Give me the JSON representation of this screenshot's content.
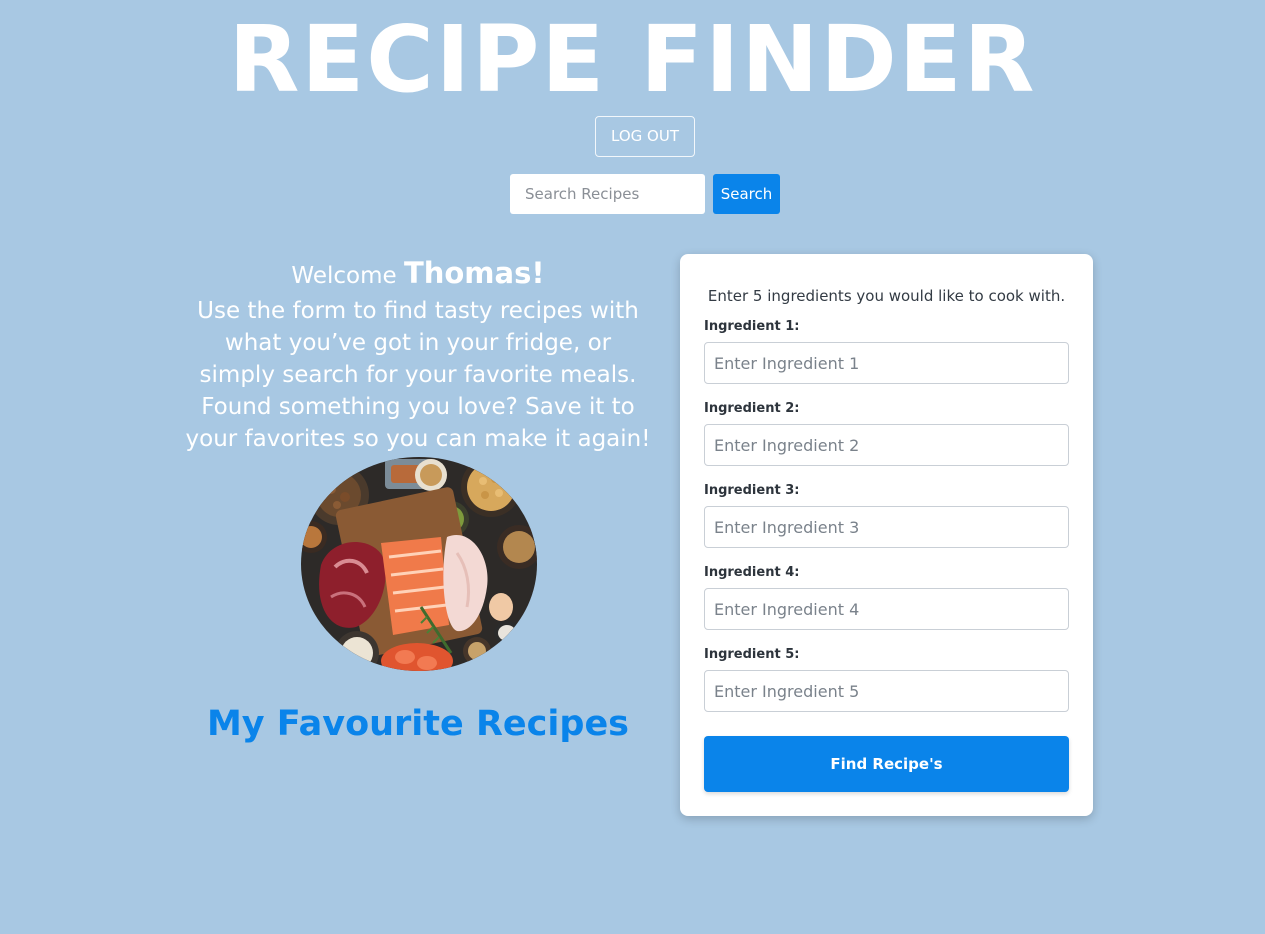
{
  "header": {
    "title": "RECIPE FINDER",
    "logout_label": "LOG OUT"
  },
  "search": {
    "placeholder": "Search Recipes",
    "value": "",
    "button_label": "Search"
  },
  "welcome": {
    "greeting": "Welcome",
    "name": "Thomas!",
    "lines": [
      "Use the form to find tasty recipes with",
      "what you’ve got in your fridge, or",
      "simply search for your favorite meals.",
      "Found something you love? Save it to",
      "your favorites so you can make it again!"
    ]
  },
  "favourites": {
    "heading": "My Favourite Recipes"
  },
  "ingredient_form": {
    "intro": "Enter 5 ingredients you would like to cook with.",
    "fields": [
      {
        "label": "Ingredient 1:",
        "placeholder": "Enter Ingredient 1",
        "value": ""
      },
      {
        "label": "Ingredient 2:",
        "placeholder": "Enter Ingredient 2",
        "value": ""
      },
      {
        "label": "Ingredient 3:",
        "placeholder": "Enter Ingredient 3",
        "value": ""
      },
      {
        "label": "Ingredient 4:",
        "placeholder": "Enter Ingredient 4",
        "value": ""
      },
      {
        "label": "Ingredient 5:",
        "placeholder": "Enter Ingredient 5",
        "value": ""
      }
    ],
    "submit_label": "Find Recipe's"
  },
  "colors": {
    "background": "#a8c8e3",
    "accent": "#0a84ea",
    "card": "#ffffff"
  }
}
